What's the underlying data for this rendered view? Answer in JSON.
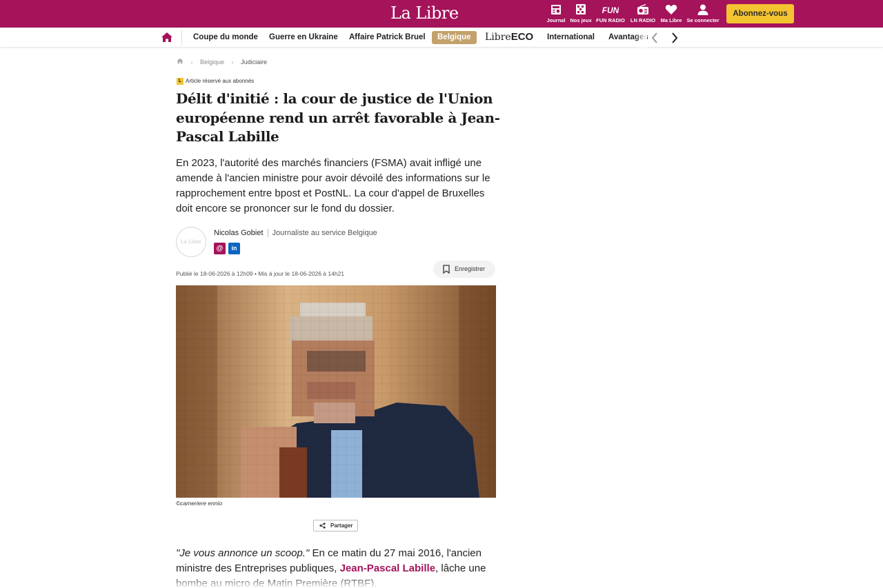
{
  "brand": {
    "logo_text": "La Libre",
    "primary_color": "#a5135b",
    "accent_color": "#f4c430"
  },
  "header": {
    "tools": [
      {
        "label": "Journal",
        "icon": "newspaper-icon"
      },
      {
        "label": "Nos jeux",
        "icon": "games-grid-icon"
      },
      {
        "label": "FUN RADIO",
        "icon": "fun-radio-logo"
      },
      {
        "label": "LN RADIO",
        "icon": "radio-icon"
      },
      {
        "label": "Ma Libre",
        "icon": "heart-icon"
      },
      {
        "label": "Se connecter",
        "icon": "user-icon"
      }
    ],
    "fun_logo": "FUN",
    "subscribe_label": "Abonnez-vous"
  },
  "nav": {
    "items": [
      "Coupe du monde",
      "Guerre en Ukraine",
      "Affaire Patrick Bruel",
      "Belgique",
      "International",
      "Avantages"
    ],
    "eco_prefix": "Libre",
    "eco_suffix": "ECO",
    "active_item": "Belgique"
  },
  "breadcrumb": {
    "items": [
      "Belgique",
      "Judiciaire"
    ]
  },
  "article": {
    "premium_badge": "L",
    "premium_label": "Article réservé aux abonnés",
    "title": "Délit d'initié : la cour de justice de l'Union européenne rend un arrêt favorable à Jean-Pascal Labille",
    "lead": "En 2023, l'autorité des marchés financiers (FSMA) avait infligé une amende à l'ancien ministre pour avoir dévoilé des informations sur le rapprochement entre bpost et PostNL. La cour d'appel de Bruxelles doit encore se prononcer sur le fond du dossier.",
    "author": {
      "avatar_text": "La Libre",
      "name": "Nicolas Gobiet",
      "role": "Journaliste au service Belgique",
      "social": [
        "@",
        "in"
      ]
    },
    "published": "Publié le 18-06-2026 à 12h09",
    "updated": "Mis à jour le 18-06-2026 à 14h21",
    "date_separator": "•",
    "save_label": "Enregistrer",
    "photo_caption": "©cameriere ennio",
    "share_label": "Partager",
    "body": {
      "quote": "\"Je vous annonce un scoop.\"",
      "text_1": " En ce matin du 27 mai 2016, l'ancien ministre des Entreprises publiques, ",
      "link": "Jean-Pascal Labille",
      "text_2": ", lâche une bombe au micro de Matin Première (RTBF)."
    }
  }
}
